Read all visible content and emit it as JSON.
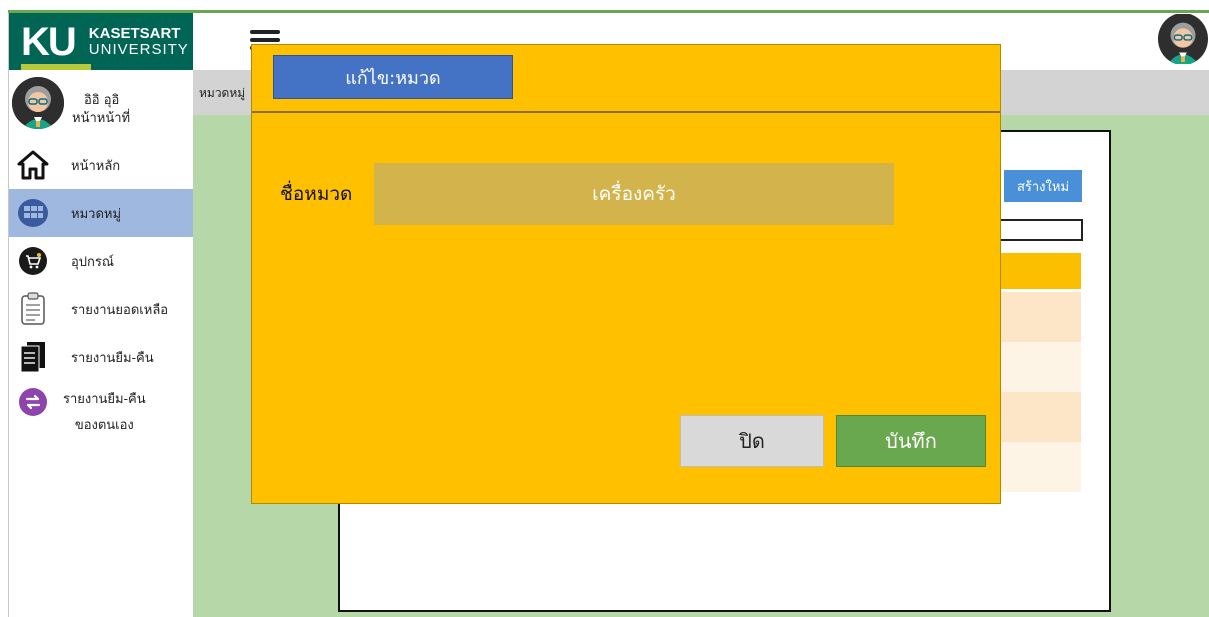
{
  "brand": {
    "logo_mark": "KU",
    "line1": "KASETSART",
    "line2": "UNIVERSITY",
    "color": "#006555",
    "accent": "#b6c93a"
  },
  "user": {
    "name": "อิอิ อุอิ",
    "role": "หน้าหน้าที่",
    "avatar_icon": "user-avatar-icon"
  },
  "sidebar": {
    "items": [
      {
        "label": "หน้าหลัก",
        "icon": "home-icon",
        "active": false
      },
      {
        "label": "หมวดหมู่",
        "icon": "category-icon",
        "active": true
      },
      {
        "label": "อุปกรณ์",
        "icon": "cart-icon",
        "active": false
      },
      {
        "label": "รายงานยอดเหลือ",
        "icon": "clipboard-icon",
        "active": false
      },
      {
        "label": "รายงานยืม-คืน",
        "icon": "documents-icon",
        "active": false
      },
      {
        "label": "รายงานยืม-คืน",
        "label2": "ของตนเอง",
        "icon": "swap-icon",
        "active": false
      }
    ]
  },
  "breadcrumb": "หมวดหมู่",
  "main": {
    "create_label": "สร้างใหม่"
  },
  "modal": {
    "title": "แก้ไข:หมวด",
    "field_label": "ชื่อหมวด",
    "field_value": "เครื่องครัว",
    "close_label": "ปิด",
    "save_label": "บันทึก"
  },
  "colors": {
    "modal_bg": "#ffc000",
    "title_bg": "#4472c4",
    "save_bg": "#6aa84f",
    "content_bg": "#b6d7a8",
    "active_nav": "#9fb8e0"
  }
}
